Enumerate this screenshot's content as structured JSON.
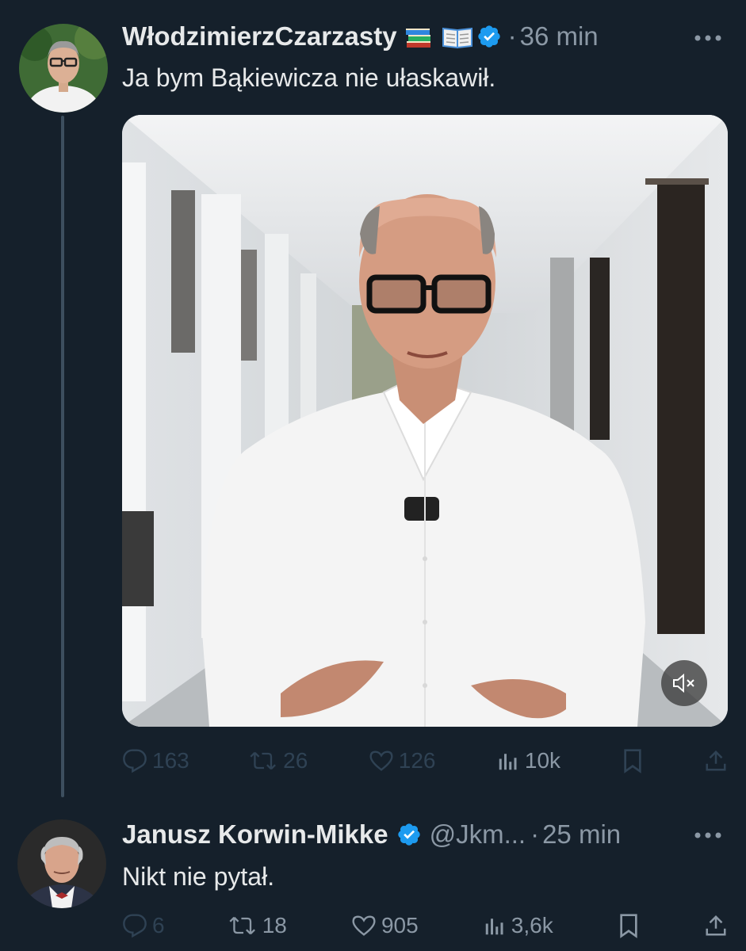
{
  "tweets": [
    {
      "author_name": "WłodzimierzCzarzasty",
      "emoji_1": "books-emoji",
      "emoji_2": "open-book-emoji",
      "verified": true,
      "handle": "",
      "separator": "·",
      "time": "36 min",
      "text": "Ja bym Bąkiewicza nie ułaskawił.",
      "media": {
        "type": "video",
        "muted": true
      },
      "stats": {
        "replies": "163",
        "retweets": "26",
        "likes": "126",
        "views": "10k"
      }
    },
    {
      "author_name": "Janusz Korwin-Mikke",
      "verified": true,
      "handle": "@Jkm...",
      "separator": "·",
      "time": "25 min",
      "text": "Nikt nie pytał.",
      "stats": {
        "replies": "6",
        "retweets": "18",
        "likes": "905",
        "views": "3,6k"
      }
    }
  ],
  "colors": {
    "background": "#15202b",
    "text_primary": "#e7e9ea",
    "text_secondary": "#8b98a5",
    "verified_blue": "#1d9bf0",
    "thread_line": "#3d4f5f"
  }
}
